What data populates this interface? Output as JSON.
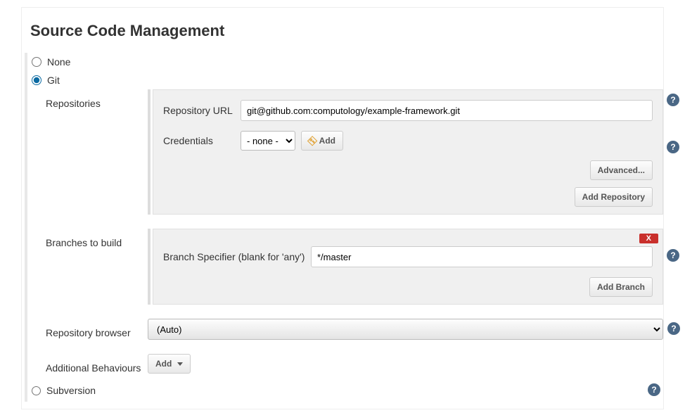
{
  "section": {
    "title": "Source Code Management"
  },
  "scm": {
    "options": {
      "none": "None",
      "git": "Git",
      "subversion": "Subversion"
    }
  },
  "git": {
    "repositories": {
      "section_label": "Repositories",
      "url_label": "Repository URL",
      "url_value": "git@github.com:computology/example-framework.git",
      "credentials_label": "Credentials",
      "credentials_selected": "- none -",
      "add_cred_label": "Add",
      "advanced_label": "Advanced...",
      "add_repo_label": "Add Repository"
    },
    "branches": {
      "section_label": "Branches to build",
      "specifier_label": "Branch Specifier (blank for 'any')",
      "specifier_value": "*/master",
      "delete_label": "X",
      "add_branch_label": "Add Branch"
    },
    "repo_browser": {
      "section_label": "Repository browser",
      "selected": "(Auto)"
    },
    "behaviours": {
      "section_label": "Additional Behaviours",
      "add_label": "Add"
    }
  },
  "help_glyph": "?"
}
